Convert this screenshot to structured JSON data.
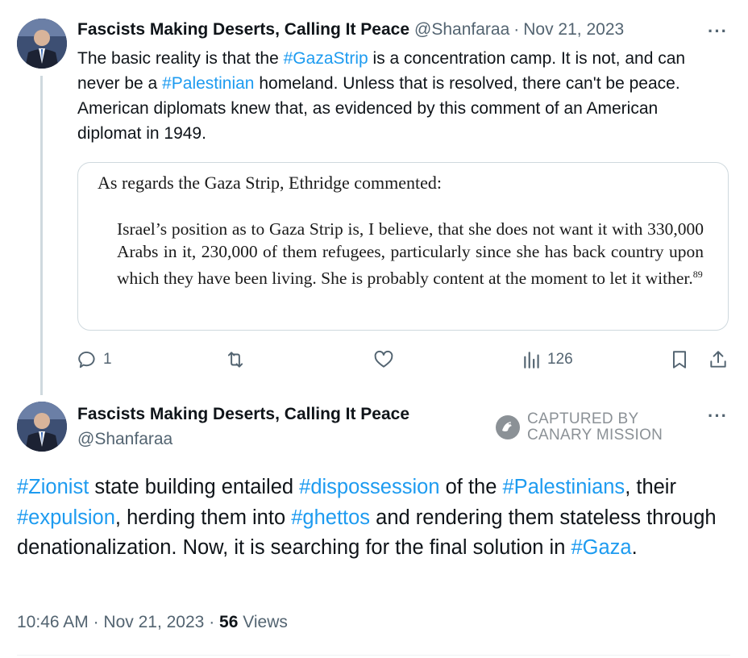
{
  "tweet1": {
    "author_name": "Fascists Making Deserts, Calling It Peace",
    "handle": "@Shanfaraa",
    "separator": "·",
    "date": "Nov 21, 2023",
    "more": "···",
    "text": {
      "p1": "The basic reality is that the ",
      "tag1": "#GazaStrip",
      "p2": " is a concentration camp. It is not, and can never be a ",
      "tag2": "#Palestinian",
      "p3": " homeland. Unless that is resolved, there can't be peace. American diplomats knew that, as evidenced by this comment of an American diplomat in 1949."
    },
    "quote_image": {
      "intro": "As regards the Gaza Strip, Ethridge commented:",
      "body": "Israel’s position as to Gaza Strip is, I believe, that she does not want it with 330,000 Arabs in it, 230,000 of them refugees, particularly since she has back country upon which they have been living. She is probably content at the moment to let it wither.",
      "footnote": "89"
    },
    "actions": {
      "replies": "1",
      "retweets": "",
      "likes": "",
      "views": "126"
    }
  },
  "tweet2": {
    "author_name": "Fascists Making Deserts, Calling It Peace",
    "handle": "@Shanfaraa",
    "more": "···",
    "text": {
      "tag1": "#Zionist",
      "p1": " state building entailed ",
      "tag2": "#dispossession",
      "p2": " of the ",
      "tag3": "#Palestinians",
      "p3": ", their ",
      "tag4": "#expulsion",
      "p4": ", herding them into ",
      "tag5": "#ghettos",
      "p5": " and rendering them stateless through denationalization. Now, it is searching for the final solution in ",
      "tag6": "#Gaza",
      "p6": "."
    },
    "meta": {
      "time": "10:46 AM",
      "sep1": "·",
      "date": "Nov 21, 2023",
      "sep2": "·",
      "views_count": "56",
      "views_label": "Views"
    }
  },
  "watermark": {
    "line1": "CAPTURED BY",
    "line2": "CANARY MISSION"
  },
  "colors": {
    "link": "#1d9bf0",
    "secondary_text": "#536471",
    "primary_text": "#0f1419",
    "border": "#cfd9de"
  },
  "icons": [
    "reply-icon",
    "retweet-icon",
    "like-icon",
    "views-icon",
    "bookmark-icon",
    "share-icon",
    "canary-mission-logo-icon"
  ]
}
